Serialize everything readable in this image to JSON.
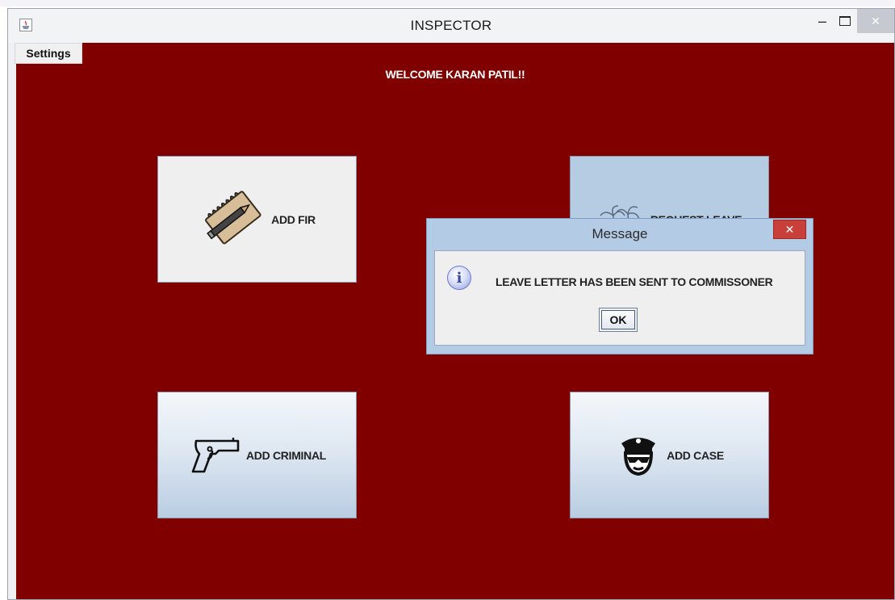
{
  "window": {
    "title": "INSPECTOR",
    "minimize_glyph": "–",
    "close_glyph": "✕"
  },
  "menu": {
    "settings_label": "Settings"
  },
  "welcome_text": "WELCOME KARAN PATIL!!",
  "tiles": {
    "add_fir": {
      "label": "ADD FIR",
      "icon": "notepad-pencil-icon"
    },
    "request_leave": {
      "label": "REQUEST LEAVE",
      "icon": "palm-trees-icon"
    },
    "add_criminal": {
      "label": "ADD CRIMINAL",
      "icon": "pistol-icon"
    },
    "add_case": {
      "label": "ADD CASE",
      "icon": "police-officer-icon"
    }
  },
  "dialog": {
    "title": "Message",
    "close_glyph": "✕",
    "icon_glyph": "i",
    "message": "LEAVE LETTER HAS BEEN SENT TO COMMISSONER",
    "ok_label": "OK"
  },
  "colors": {
    "panel_background": "#800000",
    "dialog_frame": "#b4cbe6",
    "dialog_close": "#c9403a"
  }
}
